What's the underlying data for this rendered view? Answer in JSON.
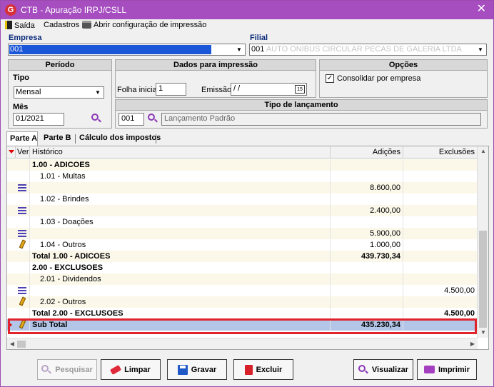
{
  "window": {
    "title": "CTB - Apuração IRPJ/CSLL",
    "close_glyph": "✕"
  },
  "menu": {
    "exit": "Saída",
    "registers": "Cadastros",
    "print_config": "Abrir configuração de impressão"
  },
  "empresa": {
    "label": "Empresa",
    "value": "001"
  },
  "filial": {
    "label": "Filial",
    "value": "001",
    "blurred_text": "AUTO ONIBUS CIRCULAR PECAS DE GALERIA LTDA"
  },
  "periodo": {
    "title": "Período",
    "tipo_label": "Tipo",
    "tipo_value": "Mensal",
    "mes_label": "Mês",
    "mes_value": "01/2021"
  },
  "impressao": {
    "title": "Dados para impressão",
    "folha_label": "Folha inicial",
    "folha_value": "1",
    "emissao_label": "Emissão",
    "emissao_value": "/ /",
    "calendar_glyph": "15"
  },
  "opcoes": {
    "title": "Opções",
    "consolidar_label": "Consolidar por empresa",
    "consolidar_checked": true,
    "check_glyph": "✓"
  },
  "tipo_lancamento": {
    "title": "Tipo de lançamento",
    "code": "001",
    "description": "Lançamento Padrão"
  },
  "tabs": [
    "Parte A",
    "Parte B",
    "Cálculo dos impostos"
  ],
  "grid": {
    "headers": {
      "ver": "Ver",
      "historico": "Histórico",
      "adicoes": "Adições",
      "exclusoes": "Exclusões"
    },
    "rows": [
      {
        "icon": "",
        "historico": "1.00 - ADICOES",
        "adicoes": "",
        "exclusoes": "",
        "bold": true
      },
      {
        "icon": "",
        "historico": "1.01 - Multas",
        "adicoes": "",
        "exclusoes": "",
        "bold": false
      },
      {
        "icon": "list",
        "historico": "",
        "adicoes": "8.600,00",
        "exclusoes": "",
        "bold": false
      },
      {
        "icon": "",
        "historico": "1.02 - Brindes",
        "adicoes": "",
        "exclusoes": "",
        "bold": false
      },
      {
        "icon": "list",
        "historico": "",
        "adicoes": "2.400,00",
        "exclusoes": "",
        "bold": false
      },
      {
        "icon": "",
        "historico": "1.03 - Doações",
        "adicoes": "",
        "exclusoes": "",
        "bold": false
      },
      {
        "icon": "list",
        "historico": "",
        "adicoes": "5.900,00",
        "exclusoes": "",
        "bold": false
      },
      {
        "icon": "pencil",
        "historico": "1.04 - Outros",
        "adicoes": "1.000,00",
        "exclusoes": "",
        "bold": false
      },
      {
        "icon": "",
        "historico": "Total 1.00 - ADICOES",
        "adicoes": "439.730,34",
        "exclusoes": "",
        "bold": true
      },
      {
        "icon": "",
        "historico": "2.00 - EXCLUSOES",
        "adicoes": "",
        "exclusoes": "",
        "bold": true
      },
      {
        "icon": "",
        "historico": "2.01 - Dividendos",
        "adicoes": "",
        "exclusoes": "",
        "bold": false
      },
      {
        "icon": "list",
        "historico": "",
        "adicoes": "",
        "exclusoes": "4.500,00",
        "bold": false
      },
      {
        "icon": "pencil",
        "historico": "2.02 - Outros",
        "adicoes": "",
        "exclusoes": "",
        "bold": false
      },
      {
        "icon": "",
        "historico": "Total 2.00 - EXCLUSOES",
        "adicoes": "",
        "exclusoes": "4.500,00",
        "bold": true
      },
      {
        "icon": "pencil",
        "historico": "Sub Total",
        "adicoes": "435.230,34",
        "exclusoes": "",
        "bold": true,
        "selected": true
      }
    ]
  },
  "buttons": {
    "pesquisar": "Pesquisar",
    "limpar": "Limpar",
    "gravar": "Gravar",
    "excluir": "Excluir",
    "visualizar": "Visualizar",
    "imprimir": "Imprimir"
  },
  "colors": {
    "titlebar": "#a64dc0",
    "accent_purple": "#8a36b5",
    "highlight_red": "#e0242d",
    "selection_blue": "#1a56d8"
  }
}
